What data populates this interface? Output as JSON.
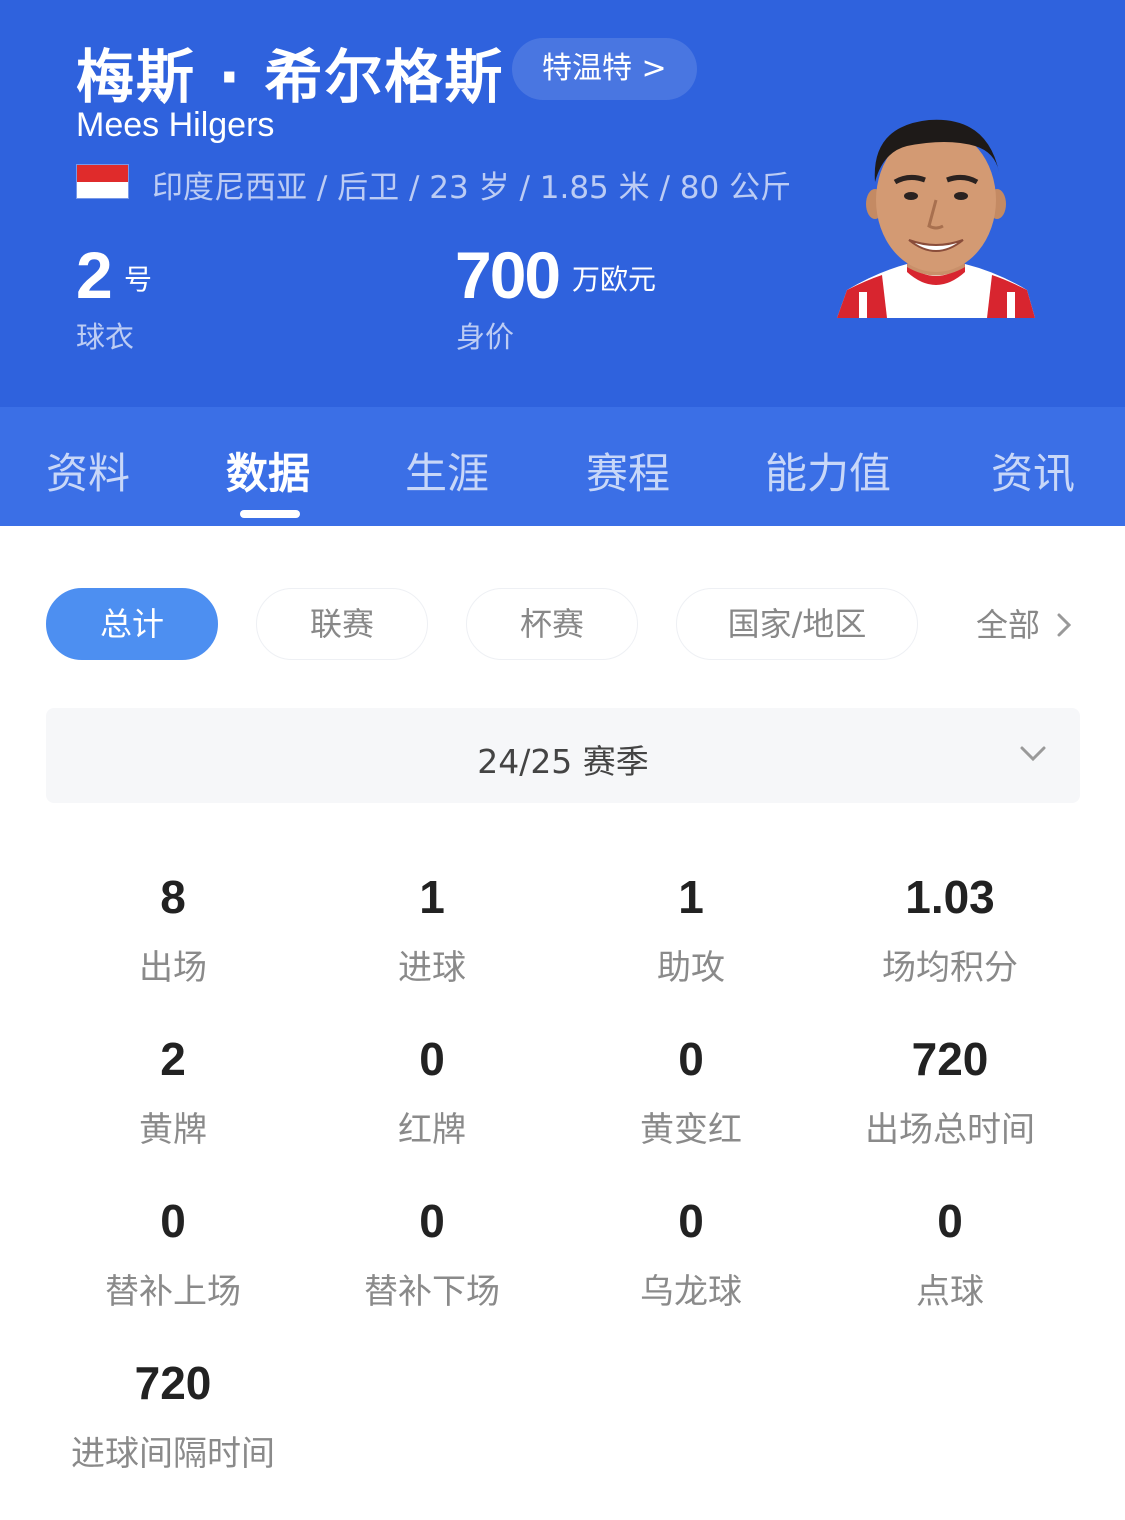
{
  "player": {
    "name_cn": "梅斯 · 希尔格斯",
    "club_link": "特温特 >",
    "name_en": "Mees Hilgers",
    "meta": "印度尼西亚 / 后卫 / 23 岁 / 1.85 米 / 80 公斤",
    "jersey_number": "2",
    "jersey_unit": "号",
    "jersey_label": "球衣",
    "market_value": "700",
    "market_value_unit": "万欧元",
    "market_value_label": "身价"
  },
  "tabs": [
    "资料",
    "数据",
    "生涯",
    "赛程",
    "能力值",
    "资讯"
  ],
  "active_tab": "数据",
  "filters": {
    "items": [
      "总计",
      "联赛",
      "杯赛",
      "国家/地区"
    ],
    "active": "总计",
    "all_label": "全部"
  },
  "season": {
    "label": "24/25 赛季"
  },
  "stats": [
    {
      "value": "8",
      "label": "出场"
    },
    {
      "value": "1",
      "label": "进球"
    },
    {
      "value": "1",
      "label": "助攻"
    },
    {
      "value": "1.03",
      "label": "场均积分"
    },
    {
      "value": "2",
      "label": "黄牌"
    },
    {
      "value": "0",
      "label": "红牌"
    },
    {
      "value": "0",
      "label": "黄变红"
    },
    {
      "value": "720",
      "label": "出场总时间"
    },
    {
      "value": "0",
      "label": "替补上场"
    },
    {
      "value": "0",
      "label": "替补下场"
    },
    {
      "value": "0",
      "label": "乌龙球"
    },
    {
      "value": "0",
      "label": "点球"
    },
    {
      "value": "720",
      "label": "进球间隔时间"
    }
  ],
  "colors": {
    "header_bg": "#2f62dd",
    "tabs_bg": "#3b6fe6",
    "active_filter": "#4d8ff1",
    "flag_red": "#e02b2b"
  },
  "icons": [
    "chevron-right-icon",
    "chevron-down-icon",
    "indonesia-flag-icon",
    "player-photo"
  ]
}
